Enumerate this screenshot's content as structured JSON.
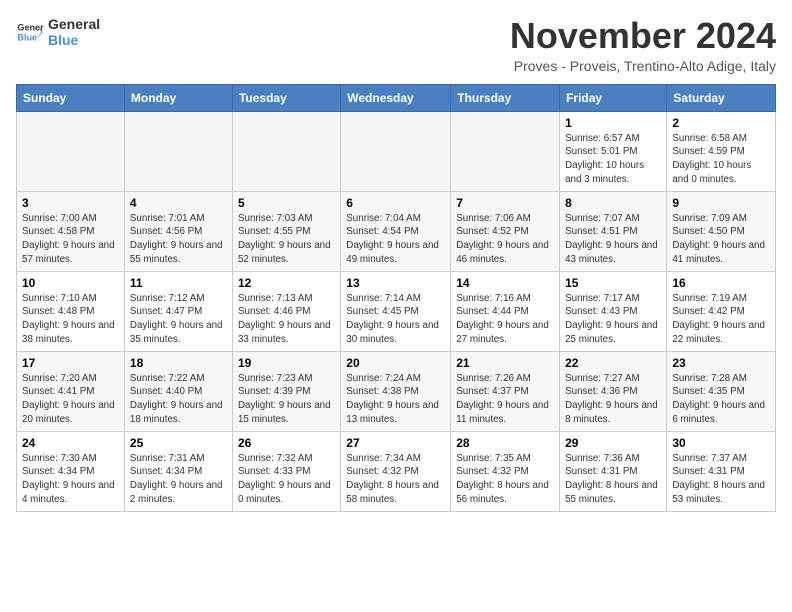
{
  "logo": {
    "line1": "General",
    "line2": "Blue"
  },
  "title": "November 2024",
  "subtitle": "Proves - Proveis, Trentino-Alto Adige, Italy",
  "headers": [
    "Sunday",
    "Monday",
    "Tuesday",
    "Wednesday",
    "Thursday",
    "Friday",
    "Saturday"
  ],
  "weeks": [
    [
      {
        "day": "",
        "info": ""
      },
      {
        "day": "",
        "info": ""
      },
      {
        "day": "",
        "info": ""
      },
      {
        "day": "",
        "info": ""
      },
      {
        "day": "",
        "info": ""
      },
      {
        "day": "1",
        "info": "Sunrise: 6:57 AM\nSunset: 5:01 PM\nDaylight: 10 hours and 3 minutes."
      },
      {
        "day": "2",
        "info": "Sunrise: 6:58 AM\nSunset: 4:59 PM\nDaylight: 10 hours and 0 minutes."
      }
    ],
    [
      {
        "day": "3",
        "info": "Sunrise: 7:00 AM\nSunset: 4:58 PM\nDaylight: 9 hours and 57 minutes."
      },
      {
        "day": "4",
        "info": "Sunrise: 7:01 AM\nSunset: 4:56 PM\nDaylight: 9 hours and 55 minutes."
      },
      {
        "day": "5",
        "info": "Sunrise: 7:03 AM\nSunset: 4:55 PM\nDaylight: 9 hours and 52 minutes."
      },
      {
        "day": "6",
        "info": "Sunrise: 7:04 AM\nSunset: 4:54 PM\nDaylight: 9 hours and 49 minutes."
      },
      {
        "day": "7",
        "info": "Sunrise: 7:06 AM\nSunset: 4:52 PM\nDaylight: 9 hours and 46 minutes."
      },
      {
        "day": "8",
        "info": "Sunrise: 7:07 AM\nSunset: 4:51 PM\nDaylight: 9 hours and 43 minutes."
      },
      {
        "day": "9",
        "info": "Sunrise: 7:09 AM\nSunset: 4:50 PM\nDaylight: 9 hours and 41 minutes."
      }
    ],
    [
      {
        "day": "10",
        "info": "Sunrise: 7:10 AM\nSunset: 4:48 PM\nDaylight: 9 hours and 38 minutes."
      },
      {
        "day": "11",
        "info": "Sunrise: 7:12 AM\nSunset: 4:47 PM\nDaylight: 9 hours and 35 minutes."
      },
      {
        "day": "12",
        "info": "Sunrise: 7:13 AM\nSunset: 4:46 PM\nDaylight: 9 hours and 33 minutes."
      },
      {
        "day": "13",
        "info": "Sunrise: 7:14 AM\nSunset: 4:45 PM\nDaylight: 9 hours and 30 minutes."
      },
      {
        "day": "14",
        "info": "Sunrise: 7:16 AM\nSunset: 4:44 PM\nDaylight: 9 hours and 27 minutes."
      },
      {
        "day": "15",
        "info": "Sunrise: 7:17 AM\nSunset: 4:43 PM\nDaylight: 9 hours and 25 minutes."
      },
      {
        "day": "16",
        "info": "Sunrise: 7:19 AM\nSunset: 4:42 PM\nDaylight: 9 hours and 22 minutes."
      }
    ],
    [
      {
        "day": "17",
        "info": "Sunrise: 7:20 AM\nSunset: 4:41 PM\nDaylight: 9 hours and 20 minutes."
      },
      {
        "day": "18",
        "info": "Sunrise: 7:22 AM\nSunset: 4:40 PM\nDaylight: 9 hours and 18 minutes."
      },
      {
        "day": "19",
        "info": "Sunrise: 7:23 AM\nSunset: 4:39 PM\nDaylight: 9 hours and 15 minutes."
      },
      {
        "day": "20",
        "info": "Sunrise: 7:24 AM\nSunset: 4:38 PM\nDaylight: 9 hours and 13 minutes."
      },
      {
        "day": "21",
        "info": "Sunrise: 7:26 AM\nSunset: 4:37 PM\nDaylight: 9 hours and 11 minutes."
      },
      {
        "day": "22",
        "info": "Sunrise: 7:27 AM\nSunset: 4:36 PM\nDaylight: 9 hours and 8 minutes."
      },
      {
        "day": "23",
        "info": "Sunrise: 7:28 AM\nSunset: 4:35 PM\nDaylight: 9 hours and 6 minutes."
      }
    ],
    [
      {
        "day": "24",
        "info": "Sunrise: 7:30 AM\nSunset: 4:34 PM\nDaylight: 9 hours and 4 minutes."
      },
      {
        "day": "25",
        "info": "Sunrise: 7:31 AM\nSunset: 4:34 PM\nDaylight: 9 hours and 2 minutes."
      },
      {
        "day": "26",
        "info": "Sunrise: 7:32 AM\nSunset: 4:33 PM\nDaylight: 9 hours and 0 minutes."
      },
      {
        "day": "27",
        "info": "Sunrise: 7:34 AM\nSunset: 4:32 PM\nDaylight: 8 hours and 58 minutes."
      },
      {
        "day": "28",
        "info": "Sunrise: 7:35 AM\nSunset: 4:32 PM\nDaylight: 8 hours and 56 minutes."
      },
      {
        "day": "29",
        "info": "Sunrise: 7:36 AM\nSunset: 4:31 PM\nDaylight: 8 hours and 55 minutes."
      },
      {
        "day": "30",
        "info": "Sunrise: 7:37 AM\nSunset: 4:31 PM\nDaylight: 8 hours and 53 minutes."
      }
    ]
  ]
}
